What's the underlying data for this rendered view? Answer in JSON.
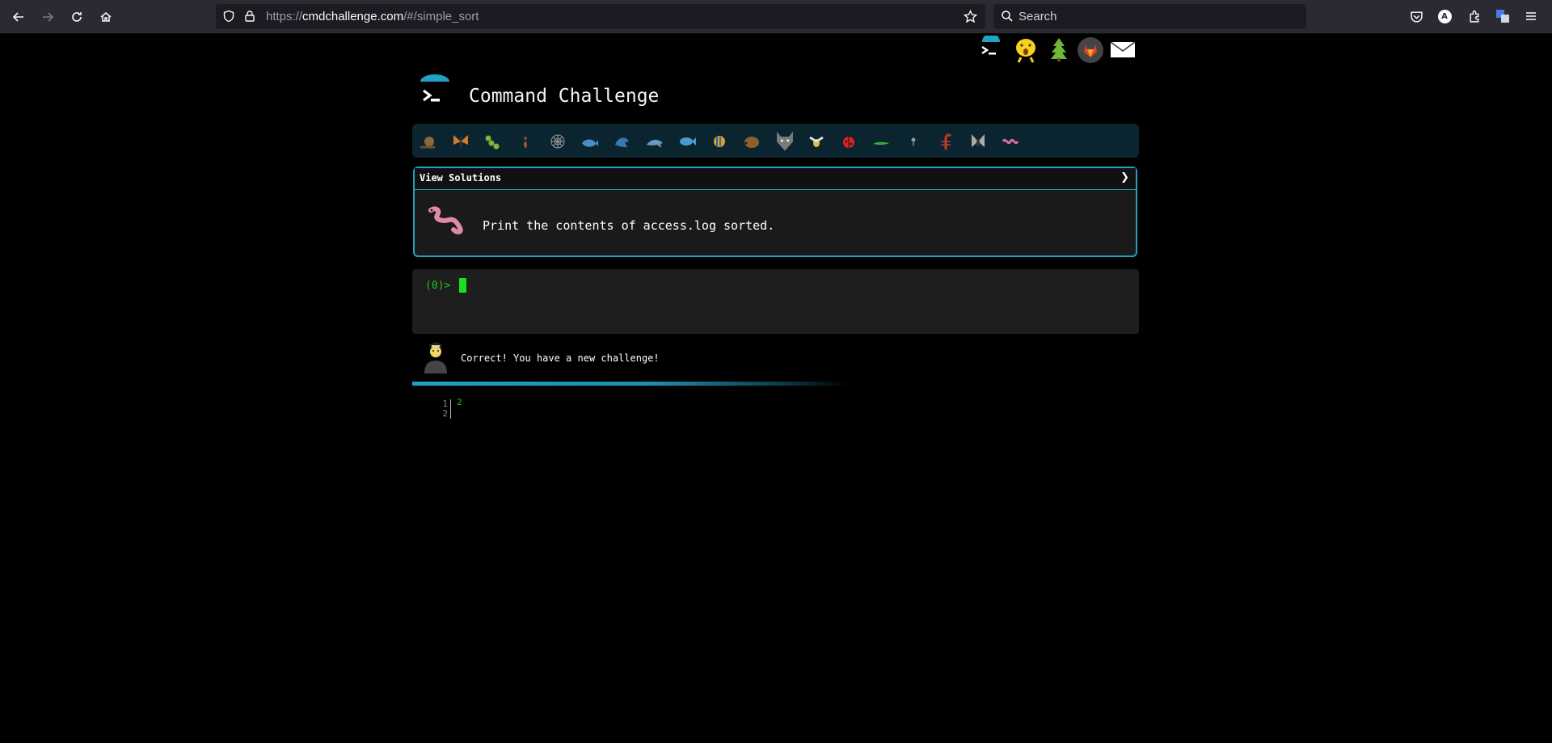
{
  "browser": {
    "url_scheme": "https://",
    "url_host": "cmdchallenge.com",
    "url_path": "/#/simple_sort",
    "search_placeholder": "Search",
    "account_initial": "A"
  },
  "header": {
    "title": "Command Challenge",
    "top_icons": [
      "terminal-logo-icon",
      "wow-emoji-icon",
      "tree-icon",
      "gitlab-icon",
      "mail-icon"
    ]
  },
  "critters": [
    "snail-icon",
    "butterfly-icon",
    "caterpillar-icon",
    "ant-icon",
    "spider-web-icon",
    "whale-icon",
    "shark-icon",
    "dolphin-icon",
    "fish-icon",
    "tropical-fish-icon",
    "hedgehog-icon",
    "wolf-icon",
    "bee-icon",
    "ladybug-icon",
    "lizard-icon",
    "bulb-icon",
    "scorpion-icon",
    "fly-icon",
    "worm-icon"
  ],
  "challenge": {
    "solutions_label": "View Solutions",
    "chevron": "❯",
    "description": "Print the contents of access.log sorted."
  },
  "terminal": {
    "prompt": "(0)>"
  },
  "feedback": {
    "message": "Correct! You have a new challenge!"
  },
  "output": {
    "line_numbers": [
      "1",
      "2"
    ],
    "text": "2"
  },
  "colors": {
    "accent": "#1fa3c4",
    "prompt_green": "#25c125",
    "panel_bg": "#1a1a1a"
  }
}
